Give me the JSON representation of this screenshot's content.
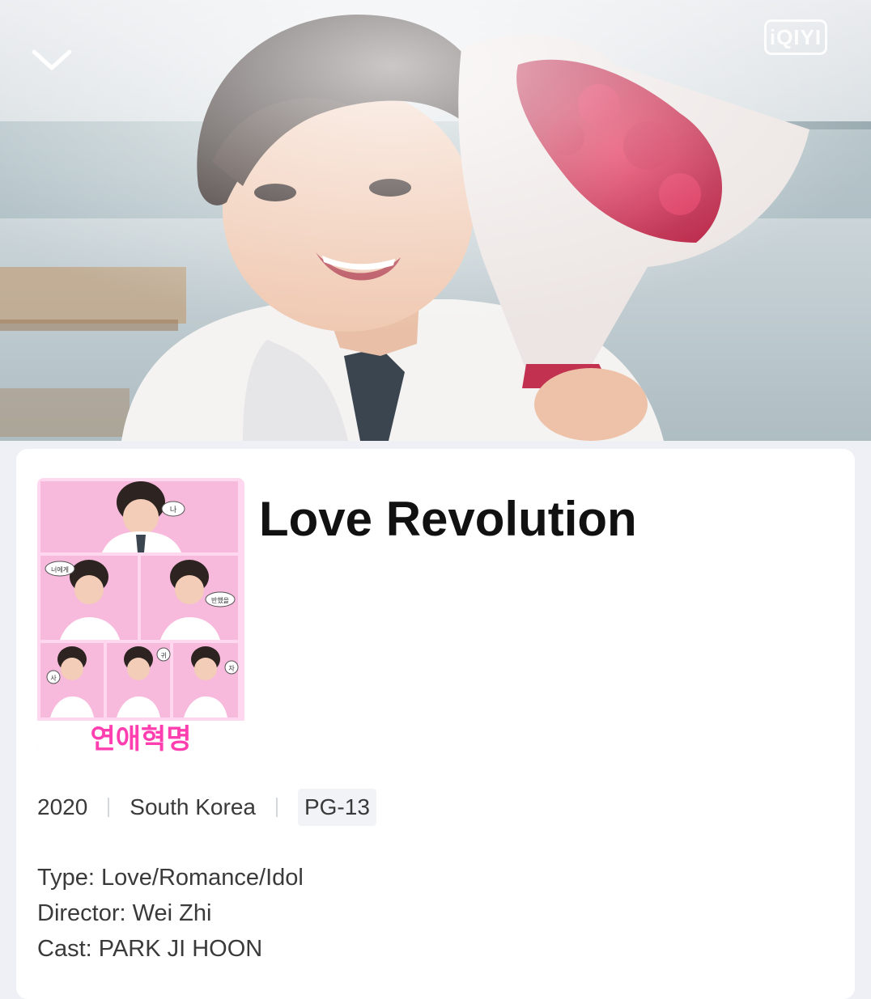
{
  "hero": {
    "brand_logo_text": "iQIYI",
    "collapse_icon": "chevron-down-icon"
  },
  "poster": {
    "korean_title": "연애혁명",
    "bubbles": [
      "나",
      "너에게",
      "반했을",
      "사",
      "귀",
      "자"
    ]
  },
  "show": {
    "title": "Love Revolution",
    "year": "2020",
    "country": "South Korea",
    "rating": "PG-13",
    "type_label": "Type:",
    "type_value": "Love/Romance/Idol",
    "director_label": "Director:",
    "director_value": "Wei Zhi",
    "cast_label": "Cast:",
    "cast_value": "PARK JI HOON"
  },
  "colors": {
    "card_bg": "#ffffff",
    "page_bg": "#eef0f5",
    "title_text": "#111111",
    "body_text": "#3a3a3a",
    "badge_bg": "#f1f3f6",
    "poster_pink": "#f7b9dc",
    "korean_title_pink": "#ff3fb0"
  }
}
